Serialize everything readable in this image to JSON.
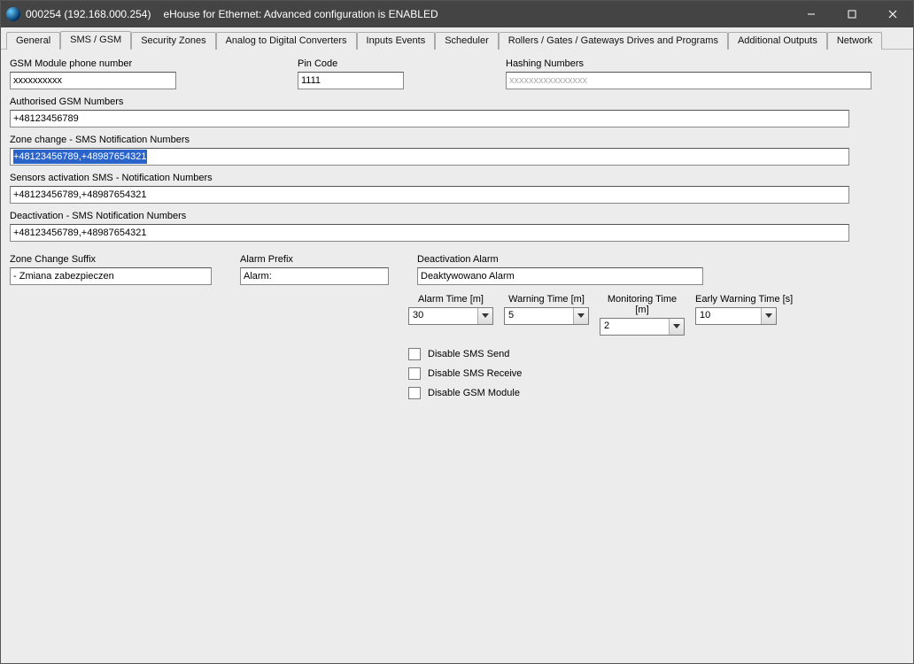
{
  "window": {
    "titleA": "000254 (192.168.000.254)",
    "titleB": "eHouse for Ethernet: Advanced configuration is ENABLED"
  },
  "tabs": [
    "General",
    "SMS / GSM",
    "Security Zones",
    "Analog to Digital Converters",
    "Inputs Events",
    "Scheduler",
    "Rollers / Gates / Gateways Drives  and Programs",
    "Additional Outputs",
    "Network"
  ],
  "activeTab": 1,
  "gsm": {
    "phone_label": "GSM Module phone number",
    "phone_value": "xxxxxxxxxx",
    "pin_label": "Pin Code",
    "pin_value": "1111",
    "hash_label": "Hashing Numbers",
    "hash_value": "xxxxxxxxxxxxxxxx",
    "auth_label": "Authorised GSM Numbers",
    "auth_value": "+48123456789",
    "zone_label": "Zone change - SMS Notification Numbers",
    "zone_value": "+48123456789,+48987654321",
    "sensors_label": "Sensors activation SMS - Notification Numbers",
    "sensors_value": "+48123456789,+48987654321",
    "deact_label": "Deactivation - SMS Notification Numbers",
    "deact_value": "+48123456789,+48987654321",
    "zcs_label": "Zone Change Suffix",
    "zcs_value": " - Zmiana zabezpieczen",
    "ap_label": "Alarm Prefix",
    "ap_value": "Alarm:",
    "da_label": "Deactivation Alarm",
    "da_value": "Deaktywowano Alarm",
    "timing": {
      "alarm_label": "Alarm Time [m]",
      "alarm_value": "30",
      "warning_label": "Warning Time [m]",
      "warning_value": "5",
      "monitoring_label": "Monitoring Time [m]",
      "monitoring_value": "2",
      "early_label": "Early Warning Time [s]",
      "early_value": "10"
    },
    "chk_disable_send": "Disable SMS Send",
    "chk_disable_recv": "Disable SMS Receive",
    "chk_disable_gsm": "Disable GSM Module"
  }
}
